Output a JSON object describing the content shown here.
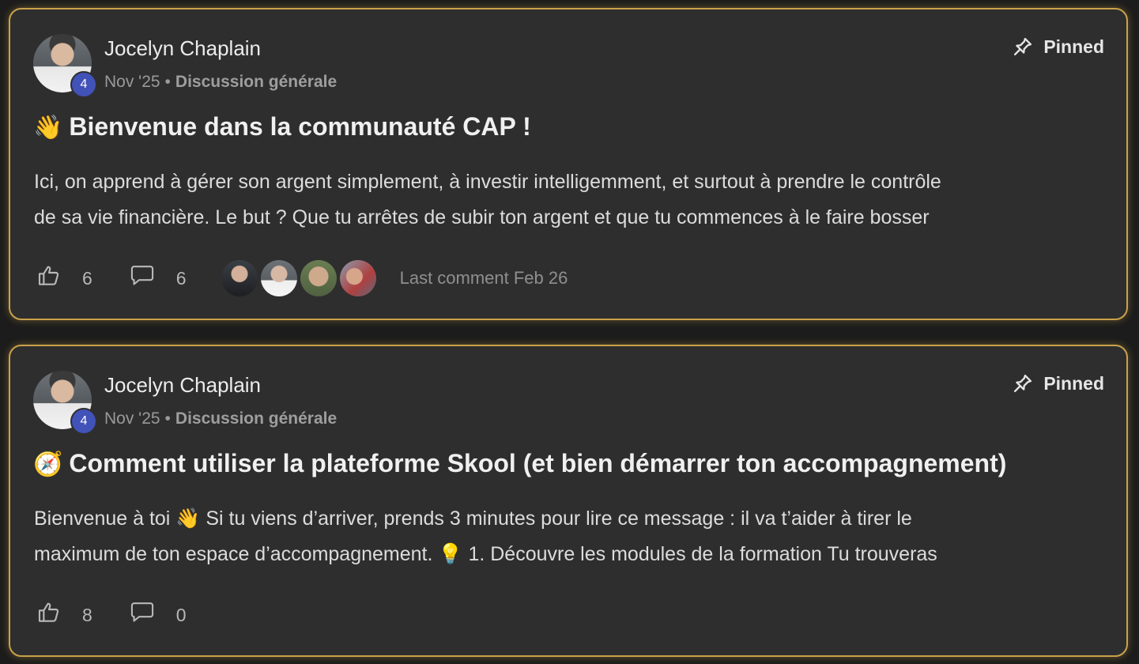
{
  "posts": [
    {
      "author": "Jocelyn Chaplain",
      "level": "4",
      "date": "Nov '25",
      "separator": "•",
      "category": "Discussion générale",
      "pinned_label": "Pinned",
      "title_emoji": "👋",
      "title": "Bienvenue dans la communauté CAP !",
      "body_lines": [
        "Ici, on apprend à gérer son argent simplement, à investir intelligemment, et surtout à prendre le contrôle",
        "de sa vie financière. Le but ? Que tu arrêtes de subir ton argent et que tu commences à le faire bosser"
      ],
      "likes": "6",
      "comments": "6",
      "last_comment": "Last comment Feb 26"
    },
    {
      "author": "Jocelyn Chaplain",
      "level": "4",
      "date": "Nov '25",
      "separator": "•",
      "category": "Discussion générale",
      "pinned_label": "Pinned",
      "title_emoji": "🧭",
      "title": "Comment utiliser la plateforme Skool (et bien démarrer ton accompagnement)",
      "body_lines": [
        "Bienvenue à toi 👋 Si tu viens d’arriver, prends 3 minutes pour lire ce message : il va t’aider à tirer le",
        "maximum de ton espace d’accompagnement. 💡 1. Découvre les modules de la formation Tu trouveras"
      ],
      "likes": "8",
      "comments": "0"
    }
  ],
  "icons": {
    "pin": "pin-icon",
    "like": "thumbs-up-icon",
    "comment": "comment-bubble-icon"
  },
  "colors": {
    "card_background": "#2e2e2e",
    "card_border": "#c9a24a",
    "level_badge": "#4152b8"
  }
}
